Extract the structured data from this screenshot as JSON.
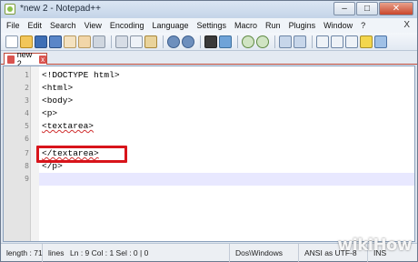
{
  "window": {
    "title": "*new 2 - Notepad++",
    "minimize": "–",
    "maximize": "□",
    "close": "✕"
  },
  "menu": {
    "items": [
      "File",
      "Edit",
      "Search",
      "View",
      "Encoding",
      "Language",
      "Settings",
      "Macro",
      "Run",
      "Plugins",
      "Window",
      "?"
    ],
    "close": "X"
  },
  "toolbar": {
    "icons": [
      "new-file-icon",
      "open-file-icon",
      "save-icon",
      "save-all-icon",
      "close-icon",
      "close-all-icon",
      "print-icon",
      "cut-icon",
      "copy-icon",
      "paste-icon",
      "undo-icon",
      "redo-icon",
      "find-icon",
      "replace-icon",
      "zoom-in-icon",
      "zoom-out-icon",
      "sync-vertical-icon",
      "sync-horizontal-icon",
      "word-wrap-icon",
      "show-all-chars-icon",
      "indent-guide-icon",
      "language-icon",
      "doc-map-icon"
    ]
  },
  "tabs": [
    {
      "label": "new 2",
      "active": true
    }
  ],
  "editor": {
    "lines": [
      {
        "num": "1",
        "code": "<!DOCTYPE html>"
      },
      {
        "num": "2",
        "code": "<html>"
      },
      {
        "num": "3",
        "code": "<body>"
      },
      {
        "num": "4",
        "code": "<p>"
      },
      {
        "num": "5",
        "code": "<textarea>"
      },
      {
        "num": "6",
        "code": ""
      },
      {
        "num": "7",
        "code": "</textarea>"
      },
      {
        "num": "8",
        "code": "</p>"
      },
      {
        "num": "9",
        "code": ""
      }
    ],
    "current_line": 9,
    "highlight_color": "#d8141b"
  },
  "status": {
    "length": "length : 71",
    "lines": "lines",
    "position": "Ln : 9    Col : 1    Sel : 0 | 0",
    "eol": "Dos\\Windows",
    "encoding": "ANSI as UTF-8",
    "mode": "INS"
  },
  "watermark": "wikiHow"
}
